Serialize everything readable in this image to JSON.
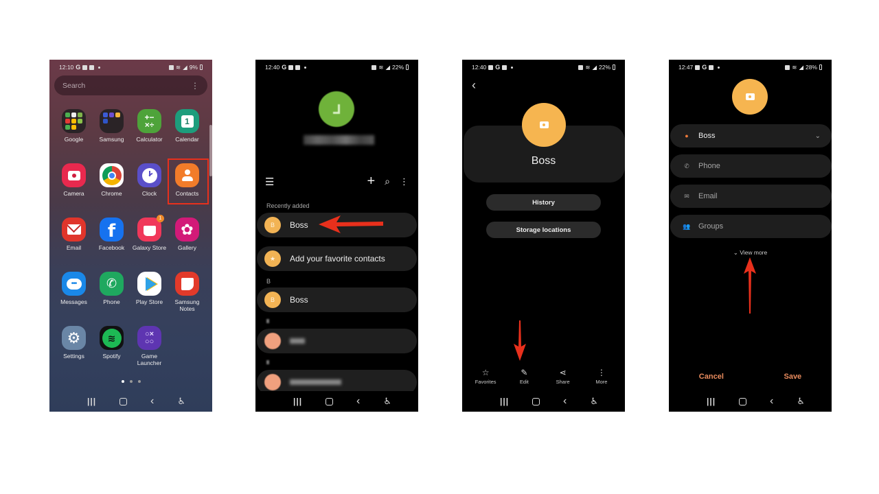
{
  "colors": {
    "annotation_red": "#e8301c",
    "contact_avatar": "#f2b354",
    "accent_orange": "#ea8c5e"
  },
  "phone1": {
    "status": {
      "time": "12:10",
      "battery": "9%"
    },
    "search_placeholder": "Search",
    "apps": [
      {
        "label": "Google",
        "icon": "google-folder-icon"
      },
      {
        "label": "Samsung",
        "icon": "samsung-folder-icon"
      },
      {
        "label": "Calculator",
        "icon": "calculator-icon"
      },
      {
        "label": "Calendar",
        "icon": "calendar-icon",
        "glyph": "1"
      },
      {
        "label": "Camera",
        "icon": "camera-icon"
      },
      {
        "label": "Chrome",
        "icon": "chrome-icon"
      },
      {
        "label": "Clock",
        "icon": "clock-icon"
      },
      {
        "label": "Contacts",
        "icon": "contacts-icon",
        "highlighted": true
      },
      {
        "label": "Email",
        "icon": "email-icon"
      },
      {
        "label": "Facebook",
        "icon": "facebook-icon",
        "glyph": "f"
      },
      {
        "label": "Galaxy Store",
        "icon": "galaxy-store-icon",
        "badge": "1"
      },
      {
        "label": "Gallery",
        "icon": "gallery-icon"
      },
      {
        "label": "Messages",
        "icon": "messages-icon"
      },
      {
        "label": "Phone",
        "icon": "phone-icon"
      },
      {
        "label": "Play Store",
        "icon": "play-store-icon"
      },
      {
        "label": "Samsung Notes",
        "icon": "samsung-notes-icon"
      },
      {
        "label": "Settings",
        "icon": "settings-icon"
      },
      {
        "label": "Spotify",
        "icon": "spotify-icon"
      },
      {
        "label": "Game Launcher",
        "icon": "game-launcher-icon"
      }
    ],
    "page_count": 3,
    "active_page": 1
  },
  "phone2": {
    "status": {
      "time": "12:40",
      "battery": "22%"
    },
    "recently_added_label": "Recently added",
    "recent_contact": {
      "initial": "B",
      "name": "Boss"
    },
    "favorites_prompt": "Add your favorite contacts",
    "section_b": "B",
    "contacts": [
      {
        "initial": "B",
        "name": "Boss"
      }
    ]
  },
  "phone3": {
    "status": {
      "time": "12:40",
      "battery": "22%"
    },
    "contact_name": "Boss",
    "buttons": {
      "history": "History",
      "storage": "Storage locations"
    },
    "actions": [
      {
        "label": "Favorites",
        "icon": "star-icon"
      },
      {
        "label": "Edit",
        "icon": "pencil-icon"
      },
      {
        "label": "Share",
        "icon": "share-icon"
      },
      {
        "label": "More",
        "icon": "more-vertical-icon"
      }
    ]
  },
  "phone4": {
    "status": {
      "time": "12:47",
      "battery": "28%"
    },
    "name_value": "Boss",
    "phone_placeholder": "Phone",
    "email_placeholder": "Email",
    "groups_label": "Groups",
    "view_more": "View more",
    "cancel": "Cancel",
    "save": "Save"
  }
}
